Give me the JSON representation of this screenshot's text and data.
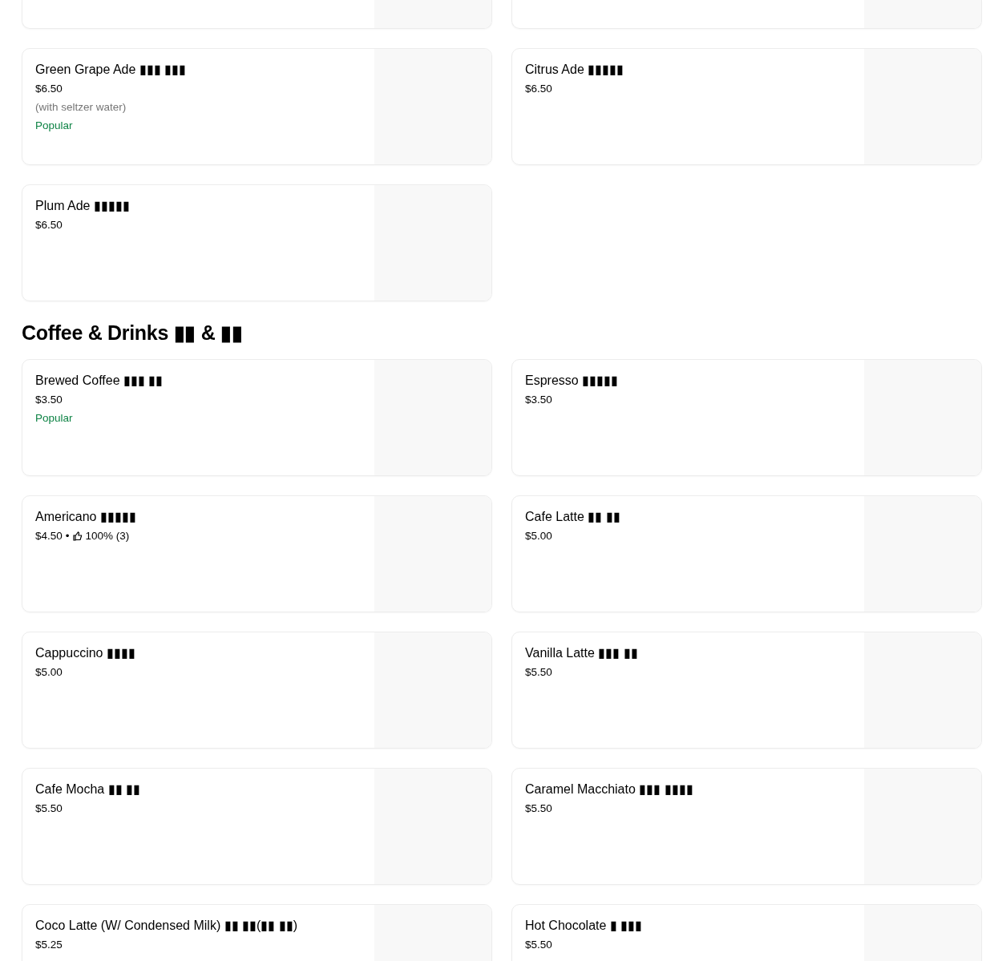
{
  "sections": [
    {
      "items": [
        {
          "kind": "cut"
        },
        {
          "kind": "cut"
        },
        {
          "kind": "item",
          "name": "Green Grape Ade ▮▮▮ ▮▮▮",
          "price": "$6.50",
          "note": "(with seltzer water)",
          "badge": "Popular"
        },
        {
          "kind": "item",
          "name": "Citrus Ade ▮▮▮▮▮",
          "price": "$6.50"
        },
        {
          "kind": "item",
          "name": "Plum Ade ▮▮▮▮▮",
          "price": "$6.50"
        }
      ]
    },
    {
      "title": "Coffee & Drinks ▮▮ & ▮▮",
      "items": [
        {
          "kind": "item",
          "name": "Brewed Coffee ▮▮▮ ▮▮",
          "price": "$3.50",
          "badge": "Popular"
        },
        {
          "kind": "item",
          "name": "Espresso ▮▮▮▮▮",
          "price": "$3.50"
        },
        {
          "kind": "item",
          "name": "Americano ▮▮▮▮▮",
          "price": "$4.50",
          "separator": "•",
          "rating": "100% (3)"
        },
        {
          "kind": "item",
          "name": "Cafe Latte ▮▮ ▮▮",
          "price": "$5.00"
        },
        {
          "kind": "item",
          "name": "Cappuccino ▮▮▮▮",
          "price": "$5.00"
        },
        {
          "kind": "item",
          "name": "Vanilla Latte ▮▮▮ ▮▮",
          "price": "$5.50"
        },
        {
          "kind": "item",
          "name": "Cafe Mocha ▮▮ ▮▮",
          "price": "$5.50"
        },
        {
          "kind": "item",
          "name": "Caramel Macchiato ▮▮▮ ▮▮▮▮",
          "price": "$5.50"
        },
        {
          "kind": "item",
          "name": "Coco Latte (W/ Condensed Milk) ▮▮ ▮▮(▮▮ ▮▮)",
          "price": "$5.25"
        },
        {
          "kind": "item",
          "name": "Hot Chocolate ▮ ▮▮▮",
          "price": "$5.50"
        }
      ]
    }
  ]
}
